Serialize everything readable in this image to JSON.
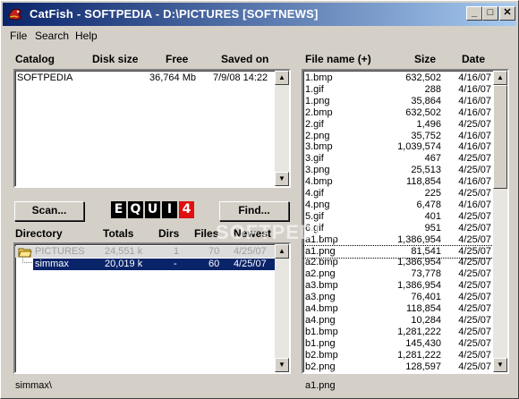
{
  "window": {
    "title": "CatFish - SOFTPEDIA - D:\\PICTURES [SOFTNEWS]"
  },
  "titlebar_buttons": {
    "minimize": "_",
    "maximize": "□",
    "close": "✕"
  },
  "menu": [
    "File",
    "Search",
    "Help"
  ],
  "catalog": {
    "headers": {
      "catalog": "Catalog",
      "disk_size": "Disk size",
      "free": "Free",
      "saved_on": "Saved on"
    },
    "rows": [
      {
        "name": "SOFTPEDIA",
        "free": "36,764 Mb",
        "saved_on": "7/9/08 14:22"
      }
    ]
  },
  "buttons": {
    "scan": "Scan...",
    "find": "Find..."
  },
  "logo": {
    "letters": [
      "E",
      "Q",
      "U",
      "I",
      "4"
    ],
    "accent": "#e01010"
  },
  "directory": {
    "headers": {
      "directory": "Directory",
      "totals": "Totals",
      "dirs": "Dirs",
      "files": "Files",
      "newest": "Newest"
    },
    "rows": [
      {
        "name": "PICTURES",
        "totals": "24,551 k",
        "dirs": "1",
        "files": "70",
        "newest": "4/25/07",
        "state": "dim"
      },
      {
        "name": "simmax",
        "totals": "20,019 k",
        "dirs": "-",
        "files": "60",
        "newest": "4/25/07",
        "state": "selected"
      }
    ]
  },
  "files": {
    "headers": {
      "name": "File name (+)",
      "size": "Size",
      "date": "Date"
    },
    "rows": [
      {
        "name": "1.bmp",
        "size": "632,502",
        "date": "4/16/07"
      },
      {
        "name": "1.gif",
        "size": "288",
        "date": "4/16/07"
      },
      {
        "name": "1.png",
        "size": "35,864",
        "date": "4/16/07"
      },
      {
        "name": "2.bmp",
        "size": "632,502",
        "date": "4/16/07"
      },
      {
        "name": "2.gif",
        "size": "1,496",
        "date": "4/25/07"
      },
      {
        "name": "2.png",
        "size": "35,752",
        "date": "4/16/07"
      },
      {
        "name": "3.bmp",
        "size": "1,039,574",
        "date": "4/16/07"
      },
      {
        "name": "3.gif",
        "size": "467",
        "date": "4/25/07"
      },
      {
        "name": "3.png",
        "size": "25,513",
        "date": "4/25/07"
      },
      {
        "name": "4.bmp",
        "size": "118,854",
        "date": "4/16/07"
      },
      {
        "name": "4.gif",
        "size": "225",
        "date": "4/25/07"
      },
      {
        "name": "4.png",
        "size": "6,478",
        "date": "4/16/07"
      },
      {
        "name": "5.gif",
        "size": "401",
        "date": "4/25/07"
      },
      {
        "name": "6.gif",
        "size": "951",
        "date": "4/25/07"
      },
      {
        "name": "a1.bmp",
        "size": "1,386,954",
        "date": "4/25/07"
      },
      {
        "name": "a1.png",
        "size": "81,541",
        "date": "4/25/07",
        "focused": true
      },
      {
        "name": "a2.bmp",
        "size": "1,386,954",
        "date": "4/25/07"
      },
      {
        "name": "a2.png",
        "size": "73,778",
        "date": "4/25/07"
      },
      {
        "name": "a3.bmp",
        "size": "1,386,954",
        "date": "4/25/07"
      },
      {
        "name": "a3.png",
        "size": "76,401",
        "date": "4/25/07"
      },
      {
        "name": "a4.bmp",
        "size": "118,854",
        "date": "4/25/07"
      },
      {
        "name": "a4.png",
        "size": "10,284",
        "date": "4/25/07"
      },
      {
        "name": "b1.bmp",
        "size": "1,281,222",
        "date": "4/25/07"
      },
      {
        "name": "b1.png",
        "size": "145,430",
        "date": "4/25/07"
      },
      {
        "name": "b2.bmp",
        "size": "1,281,222",
        "date": "4/25/07"
      },
      {
        "name": "b2.png",
        "size": "128,597",
        "date": "4/25/07"
      }
    ]
  },
  "status": {
    "left": "simmax\\",
    "right": "a1.png"
  },
  "watermark": "SOFTPEDIA"
}
